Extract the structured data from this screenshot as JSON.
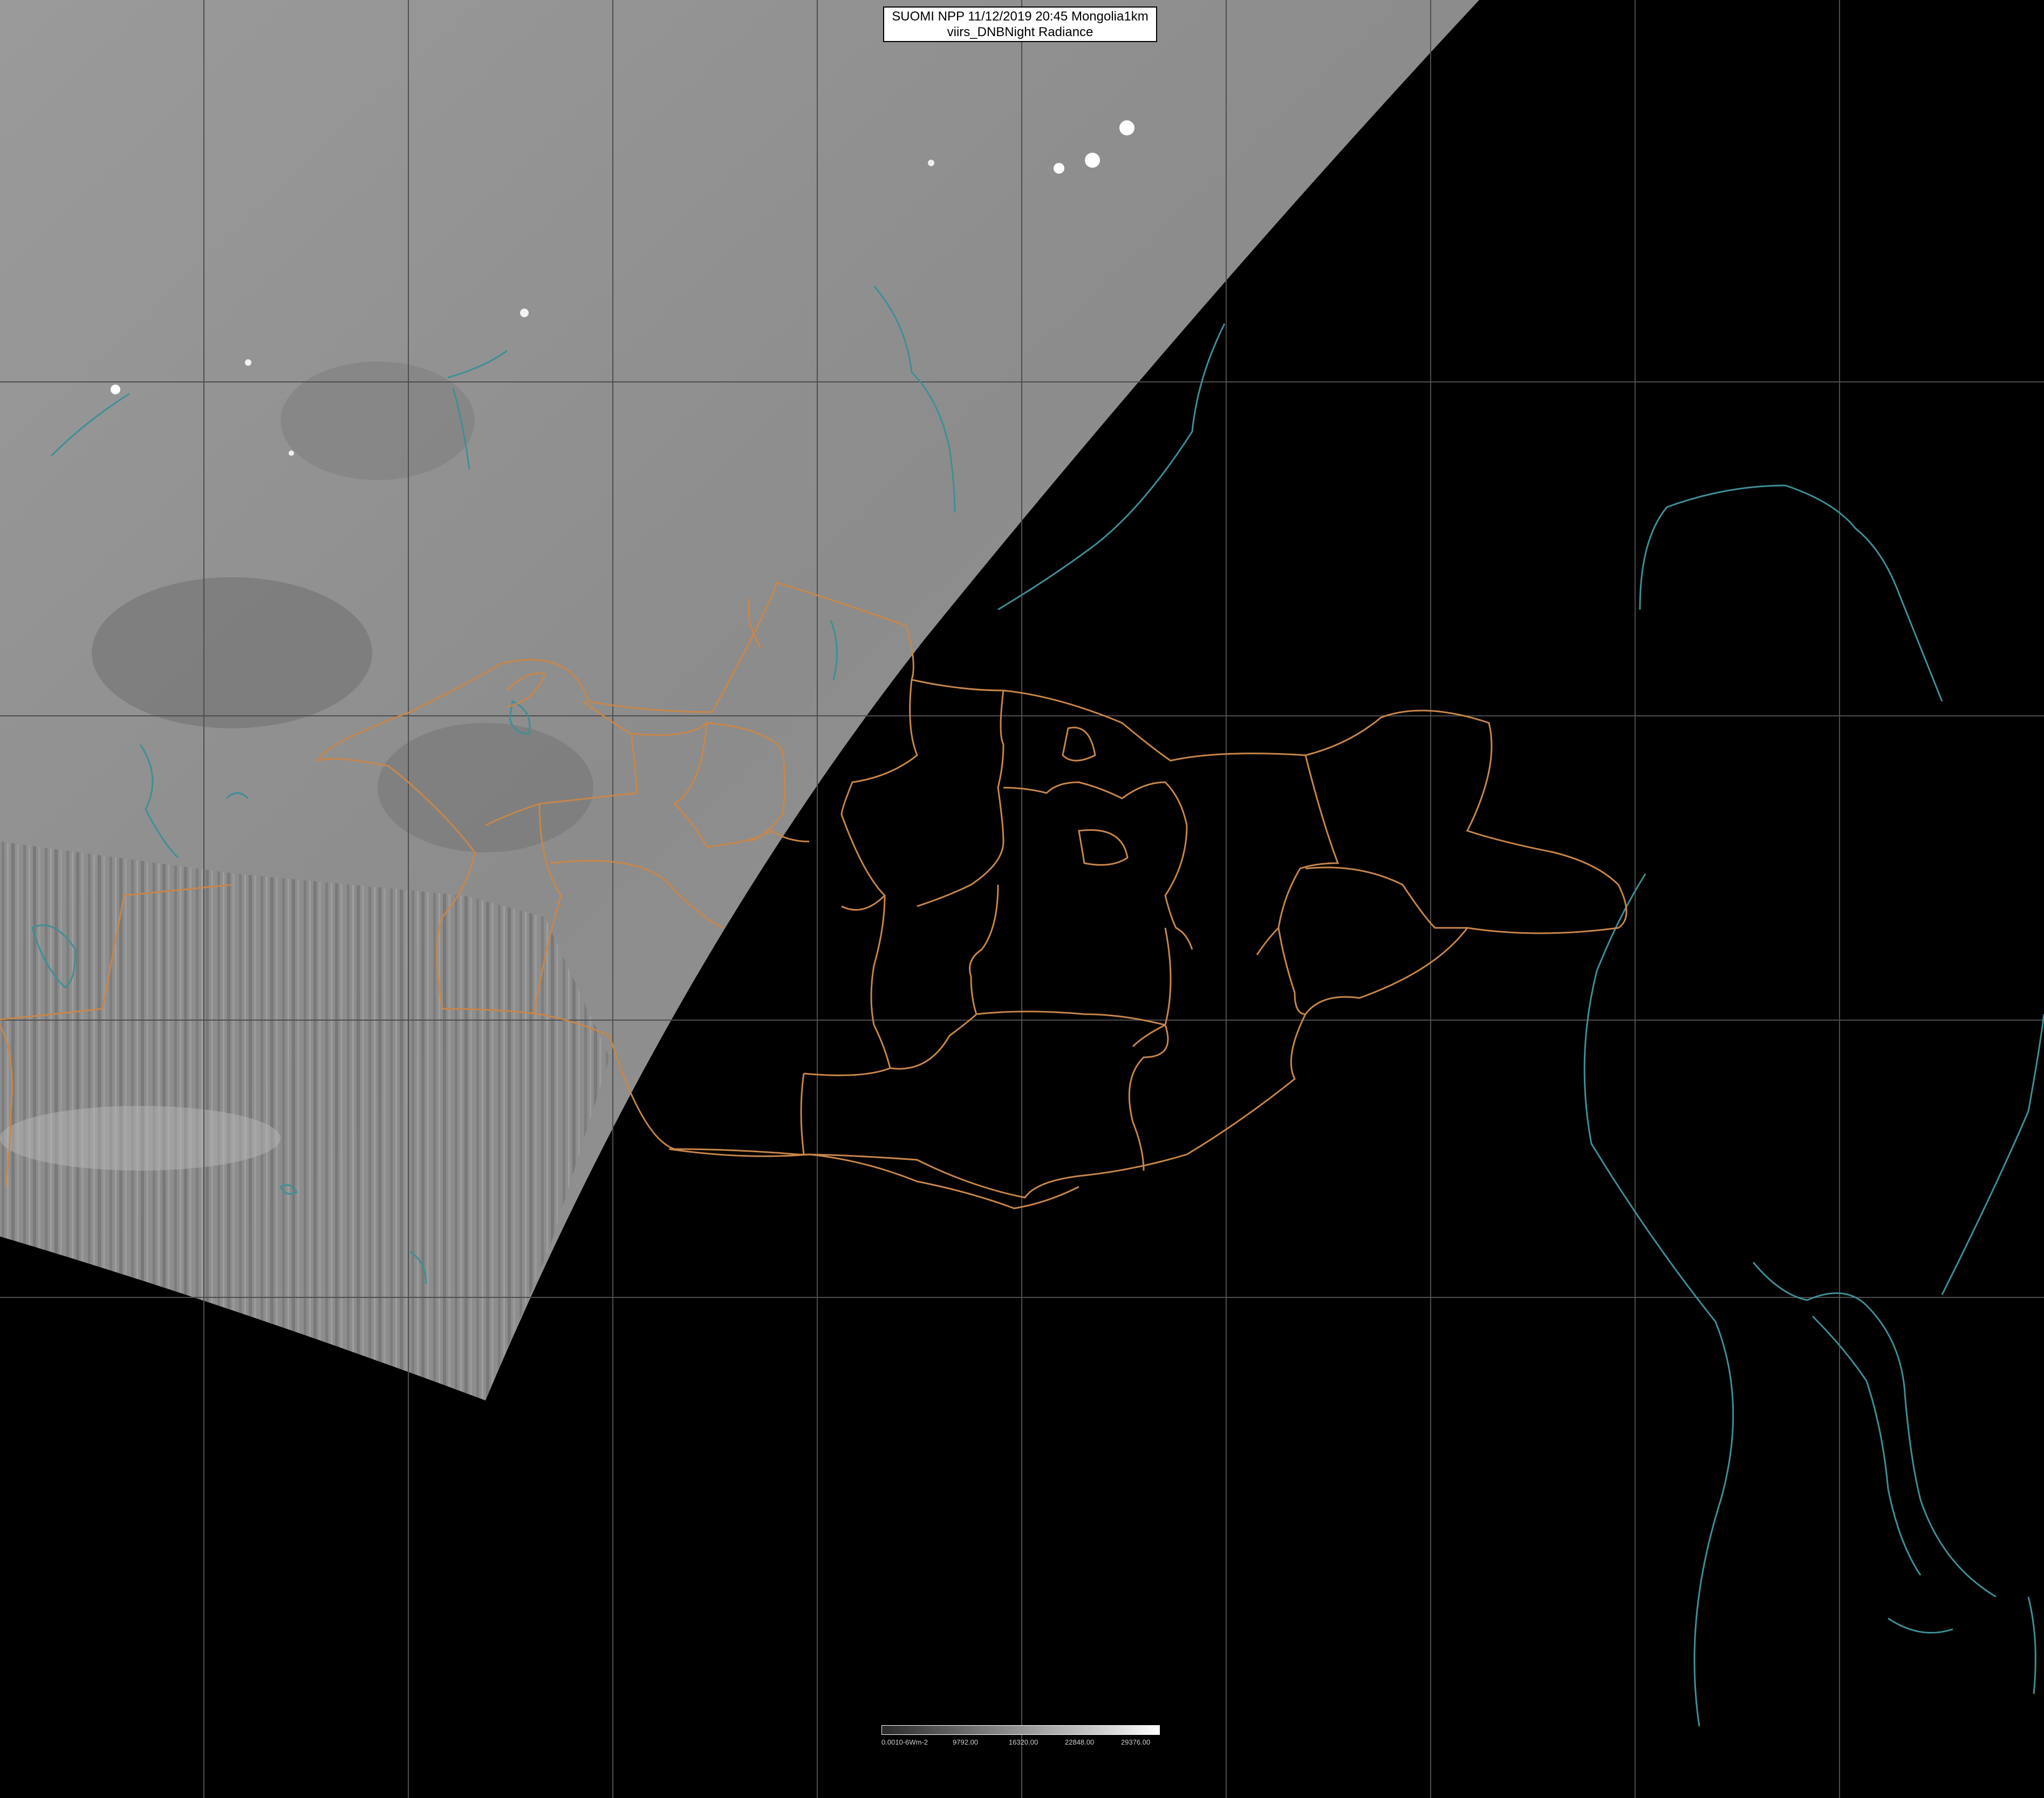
{
  "title": {
    "line1": "SUOMI NPP 11/12/2019 20:45 Mongolia1km",
    "line2": "viirs_DNBNight Radiance"
  },
  "colorbar": {
    "labels": [
      "0.0010-6Wm-2",
      "9792.00",
      "16320.00",
      "22848.00",
      "29376.00"
    ]
  },
  "colors": {
    "background": "#000000",
    "swath_gray": "#929292",
    "graticule": "#4a4a4a",
    "border_orange": "#c8864a",
    "coast_teal": "#3f8f96"
  },
  "icons": [
    "map-graticule",
    "satellite-swath",
    "province-boundary",
    "coastline"
  ]
}
